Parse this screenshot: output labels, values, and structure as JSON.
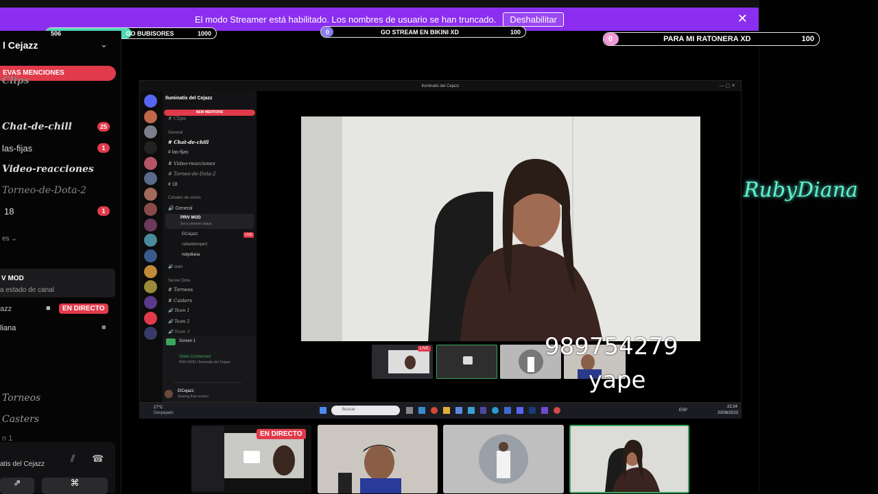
{
  "banner": {
    "message": "El modo Streamer está habilitado. Los nombres de usuario se han truncado.",
    "button_label": "Deshabilitar"
  },
  "goals": [
    {
      "current": "506",
      "label": "GO BUBISORES",
      "target": "1000",
      "fraction": 0.506,
      "color": "#4fd8b4"
    },
    {
      "current": "0",
      "label": "GO STREAM EN BIKINI XD",
      "target": "100",
      "fraction": 0.0,
      "color": "#8a7cf0"
    },
    {
      "current": "0",
      "label": "PARA MI RATONERA XD",
      "target": "100",
      "fraction": 0.0,
      "color": "#f29ad9"
    }
  ],
  "sidebar": {
    "server_name": "l Cejazz",
    "mentions_label": "EVAS MENCIONES",
    "channels": [
      {
        "name": "Clips"
      },
      {
        "name": "Chat-de-chill",
        "badge": "25"
      },
      {
        "name": "las-fijas",
        "badge": "1"
      },
      {
        "name": "Video-reacciones"
      },
      {
        "name": "Torneo-de-Dota-2"
      },
      {
        "name": "18",
        "badge": "1"
      }
    ],
    "section_voice": "es",
    "voice_channel": "V MOD",
    "voice_status": "a estado de canal",
    "user1": "azz",
    "live_label": "EN DIRECTO",
    "user2": "liana",
    "lower_channels": [
      "Torneos",
      "Casters",
      "n 1"
    ],
    "panel_label": "atis del Cejazz"
  },
  "inner": {
    "window_title": "Iluminatis del Cejazz",
    "server_name": "Iluminatis del Cejazz",
    "mentions_label": "NEW MENTIONS",
    "channels": [
      "Clips",
      "Chat-de-chill",
      "las-fijas",
      "Video-reacciones",
      "Torneo-de-Dota-2",
      "18"
    ],
    "category_general": "General",
    "category_voice": "Canales de voces",
    "voice_general": "General",
    "voice_priv": "PRIV MOD",
    "voice_priv_status": "Set a channel status",
    "voice_users": [
      "ElCejazz",
      "rafaeldempert",
      "rubydiana"
    ],
    "live_label": "LIVE",
    "voice_crar": "crarr",
    "category_dota": "Server Dota",
    "dota_channels": [
      "Torneos",
      "Casters",
      "Team 1",
      "Team 2",
      "Team 3"
    ],
    "screen_label": "Screen 1",
    "video_connected": "Video Connected",
    "video_connected_sub": "PRIV MOD / Iluminatis del Cejazz",
    "user_name": "ElCejazz",
    "user_status": "Sharing their screen",
    "weather_temp": "17°C",
    "weather_desc": "Despejado",
    "search_placeholder": "Buscar",
    "lang": "ESP",
    "time": "22:24",
    "date": "20/08/2023",
    "thumb_live": "LIVE"
  },
  "overlay": {
    "phone": "989754279",
    "yape": "yape",
    "signature": "RubyDiana"
  },
  "bottom_tiles": {
    "live_label": "EN DIRECTO"
  }
}
